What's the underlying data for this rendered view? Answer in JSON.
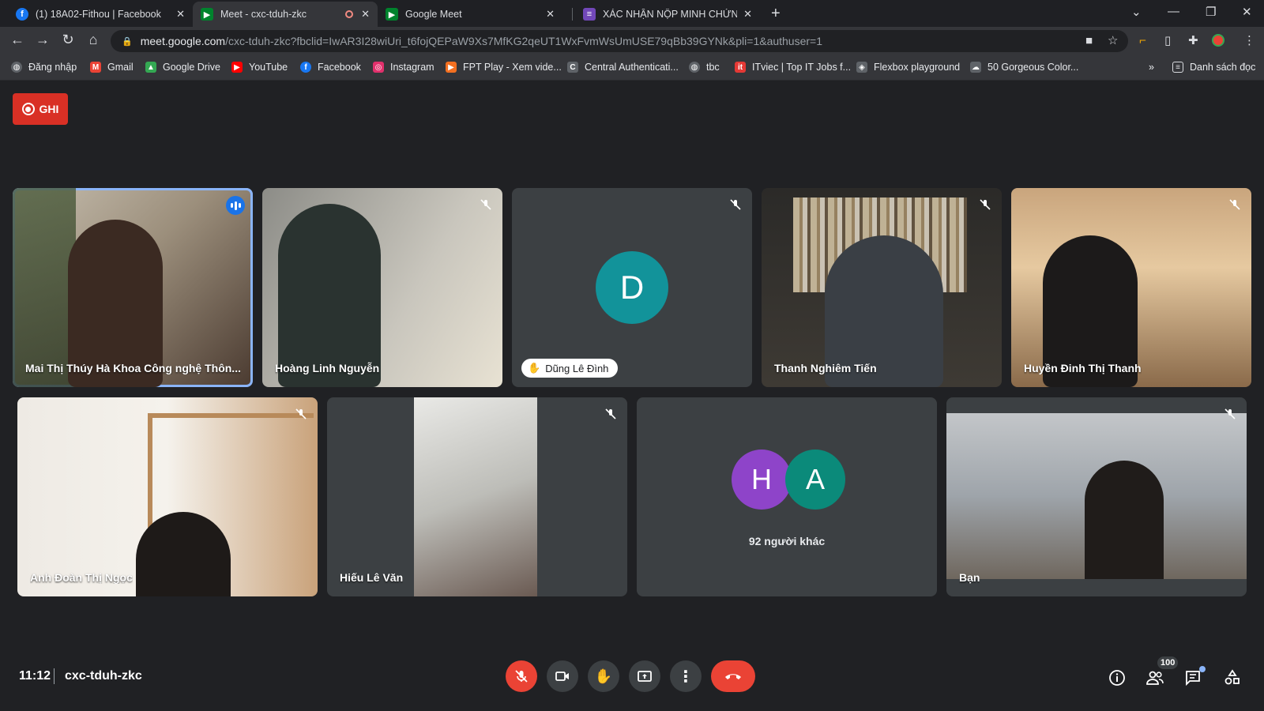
{
  "browser": {
    "tabs": [
      {
        "title": "(1) 18A02-Fithou | Facebook",
        "icon": "facebook-icon"
      },
      {
        "title": "Meet - cxc-tduh-zkc",
        "icon": "google-meet-icon",
        "recording": true
      },
      {
        "title": "Google Meet",
        "icon": "google-meet-icon"
      },
      {
        "title": "XÁC NHẬN NỘP MINH CHỨNG Đ",
        "icon": "google-forms-icon"
      }
    ],
    "url_host": "meet.google.com",
    "url_path": "/cxc-tduh-zkc?fbclid=IwAR3I28wiUri_t6fojQEPaW9Xs7MfKG2qeUT1WxFvmWsUmUSE79qBb39GYNk&pli=1&authuser=1",
    "bookmarks": [
      {
        "label": "Đăng nhập",
        "color": "#ffffff"
      },
      {
        "label": "Gmail",
        "color": "#ea4335"
      },
      {
        "label": "Google Drive",
        "color": "#34a853"
      },
      {
        "label": "YouTube",
        "color": "#ff0000"
      },
      {
        "label": "Facebook",
        "color": "#1877f2"
      },
      {
        "label": "Instagram",
        "color": "#e1306c"
      },
      {
        "label": "FPT Play - Xem vide...",
        "color": "#f37021"
      },
      {
        "label": "Central Authenticati...",
        "color": "#dadce0"
      },
      {
        "label": "tbc",
        "color": "#dadce0"
      },
      {
        "label": "ITviec | Top IT Jobs f...",
        "color": "#e53935"
      },
      {
        "label": "Flexbox playground",
        "color": "#dadce0"
      },
      {
        "label": "50 Gorgeous Color...",
        "color": "#dadce0"
      }
    ],
    "more_bookmarks": "»",
    "reading_list": "Danh sách đọc"
  },
  "meet": {
    "record_label": "GHI",
    "participants": [
      {
        "name": "Mai Thị Thúy Hà Khoa Công nghệ Thôn...",
        "speaking": true
      },
      {
        "name": "Hoàng Linh Nguyễn",
        "muted": true
      },
      {
        "name": "Dũng Lê Đình",
        "muted": true,
        "avatar_letter": "D",
        "avatar_color": "#12939a",
        "hand_raised": true
      },
      {
        "name": "Thanh Nghiêm Tiến",
        "muted": true
      },
      {
        "name": "Huyền Đinh Thị Thanh",
        "muted": true
      },
      {
        "name": "Anh Đoàn Thị Ngọc",
        "muted": true
      },
      {
        "name": "Hiếu Lê Văn",
        "muted": true
      },
      {
        "name": "Bạn",
        "muted": true
      }
    ],
    "others": {
      "label": "92 người khác",
      "avatars": [
        {
          "letter": "H",
          "color": "#8e44c9"
        },
        {
          "letter": "A",
          "color": "#0b8a7a"
        }
      ]
    },
    "time": "11:12",
    "meeting_code": "cxc-tduh-zkc",
    "people_count": "100",
    "controls": [
      "mic-off-icon",
      "camera-icon",
      "raise-hand-icon",
      "present-icon",
      "more-options-icon",
      "end-call-icon"
    ],
    "right_controls": [
      "info-icon",
      "people-icon",
      "chat-icon",
      "activities-icon"
    ],
    "colors": {
      "red": "#ea4335",
      "speaking_outline": "#8ab4f8",
      "bg": "#202124",
      "tile": "#3c4043"
    }
  }
}
